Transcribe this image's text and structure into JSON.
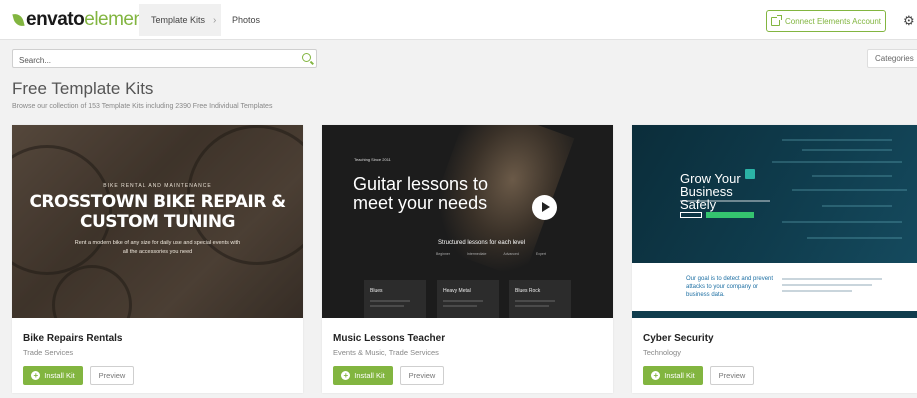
{
  "header": {
    "logo_text": "envato",
    "logo_text2": "elements",
    "tabs": [
      {
        "label": "Template Kits",
        "chevron": "›"
      },
      {
        "label": "Photos"
      }
    ],
    "connect_label": "Connect Elements Account",
    "connect_icon": "external-link-icon",
    "settings_icon": "gear-icon"
  },
  "search": {
    "placeholder": "Search...",
    "icon": "search-icon"
  },
  "categories": {
    "label": "Categories",
    "chevron": "›"
  },
  "page": {
    "title": "Free Template Kits",
    "subtitle": "Browse our collection of 153 Template Kits including 2390 Free Individual Templates"
  },
  "colors": {
    "accent": "#82b540"
  },
  "cards": [
    {
      "name": "Bike Repairs Rentals",
      "category": "Trade Services",
      "install_label": "Install Kit",
      "preview_label": "Preview",
      "thumb": {
        "kicker": "BIKE RENTAL AND MAINTENANCE",
        "headline": "CROSSTOWN BIKE REPAIR & CUSTOM TUNING",
        "desc": "Rent a modern bike of any size for daily use and special events with all the accessories you need"
      }
    },
    {
      "name": "Music Lessons Teacher",
      "category": "Events & Music, Trade Services",
      "install_label": "Install Kit",
      "preview_label": "Preview",
      "thumb": {
        "tag": "Teaching Since 2011",
        "headline": "Guitar lessons to meet your needs",
        "structured": "Structured lessons for each level",
        "levels": [
          "Beginner",
          "Intermediate",
          "Advanced",
          "Expert"
        ],
        "boxes": [
          "Blues",
          "Heavy Metal",
          "Blues Rock"
        ]
      }
    },
    {
      "name": "Cyber Security",
      "category": "Technology",
      "install_label": "Install Kit",
      "preview_label": "Preview",
      "thumb": {
        "headline": "Grow Your Business Safely",
        "goal": "Our goal is to detect and prevent attacks to your company or business data."
      }
    }
  ]
}
